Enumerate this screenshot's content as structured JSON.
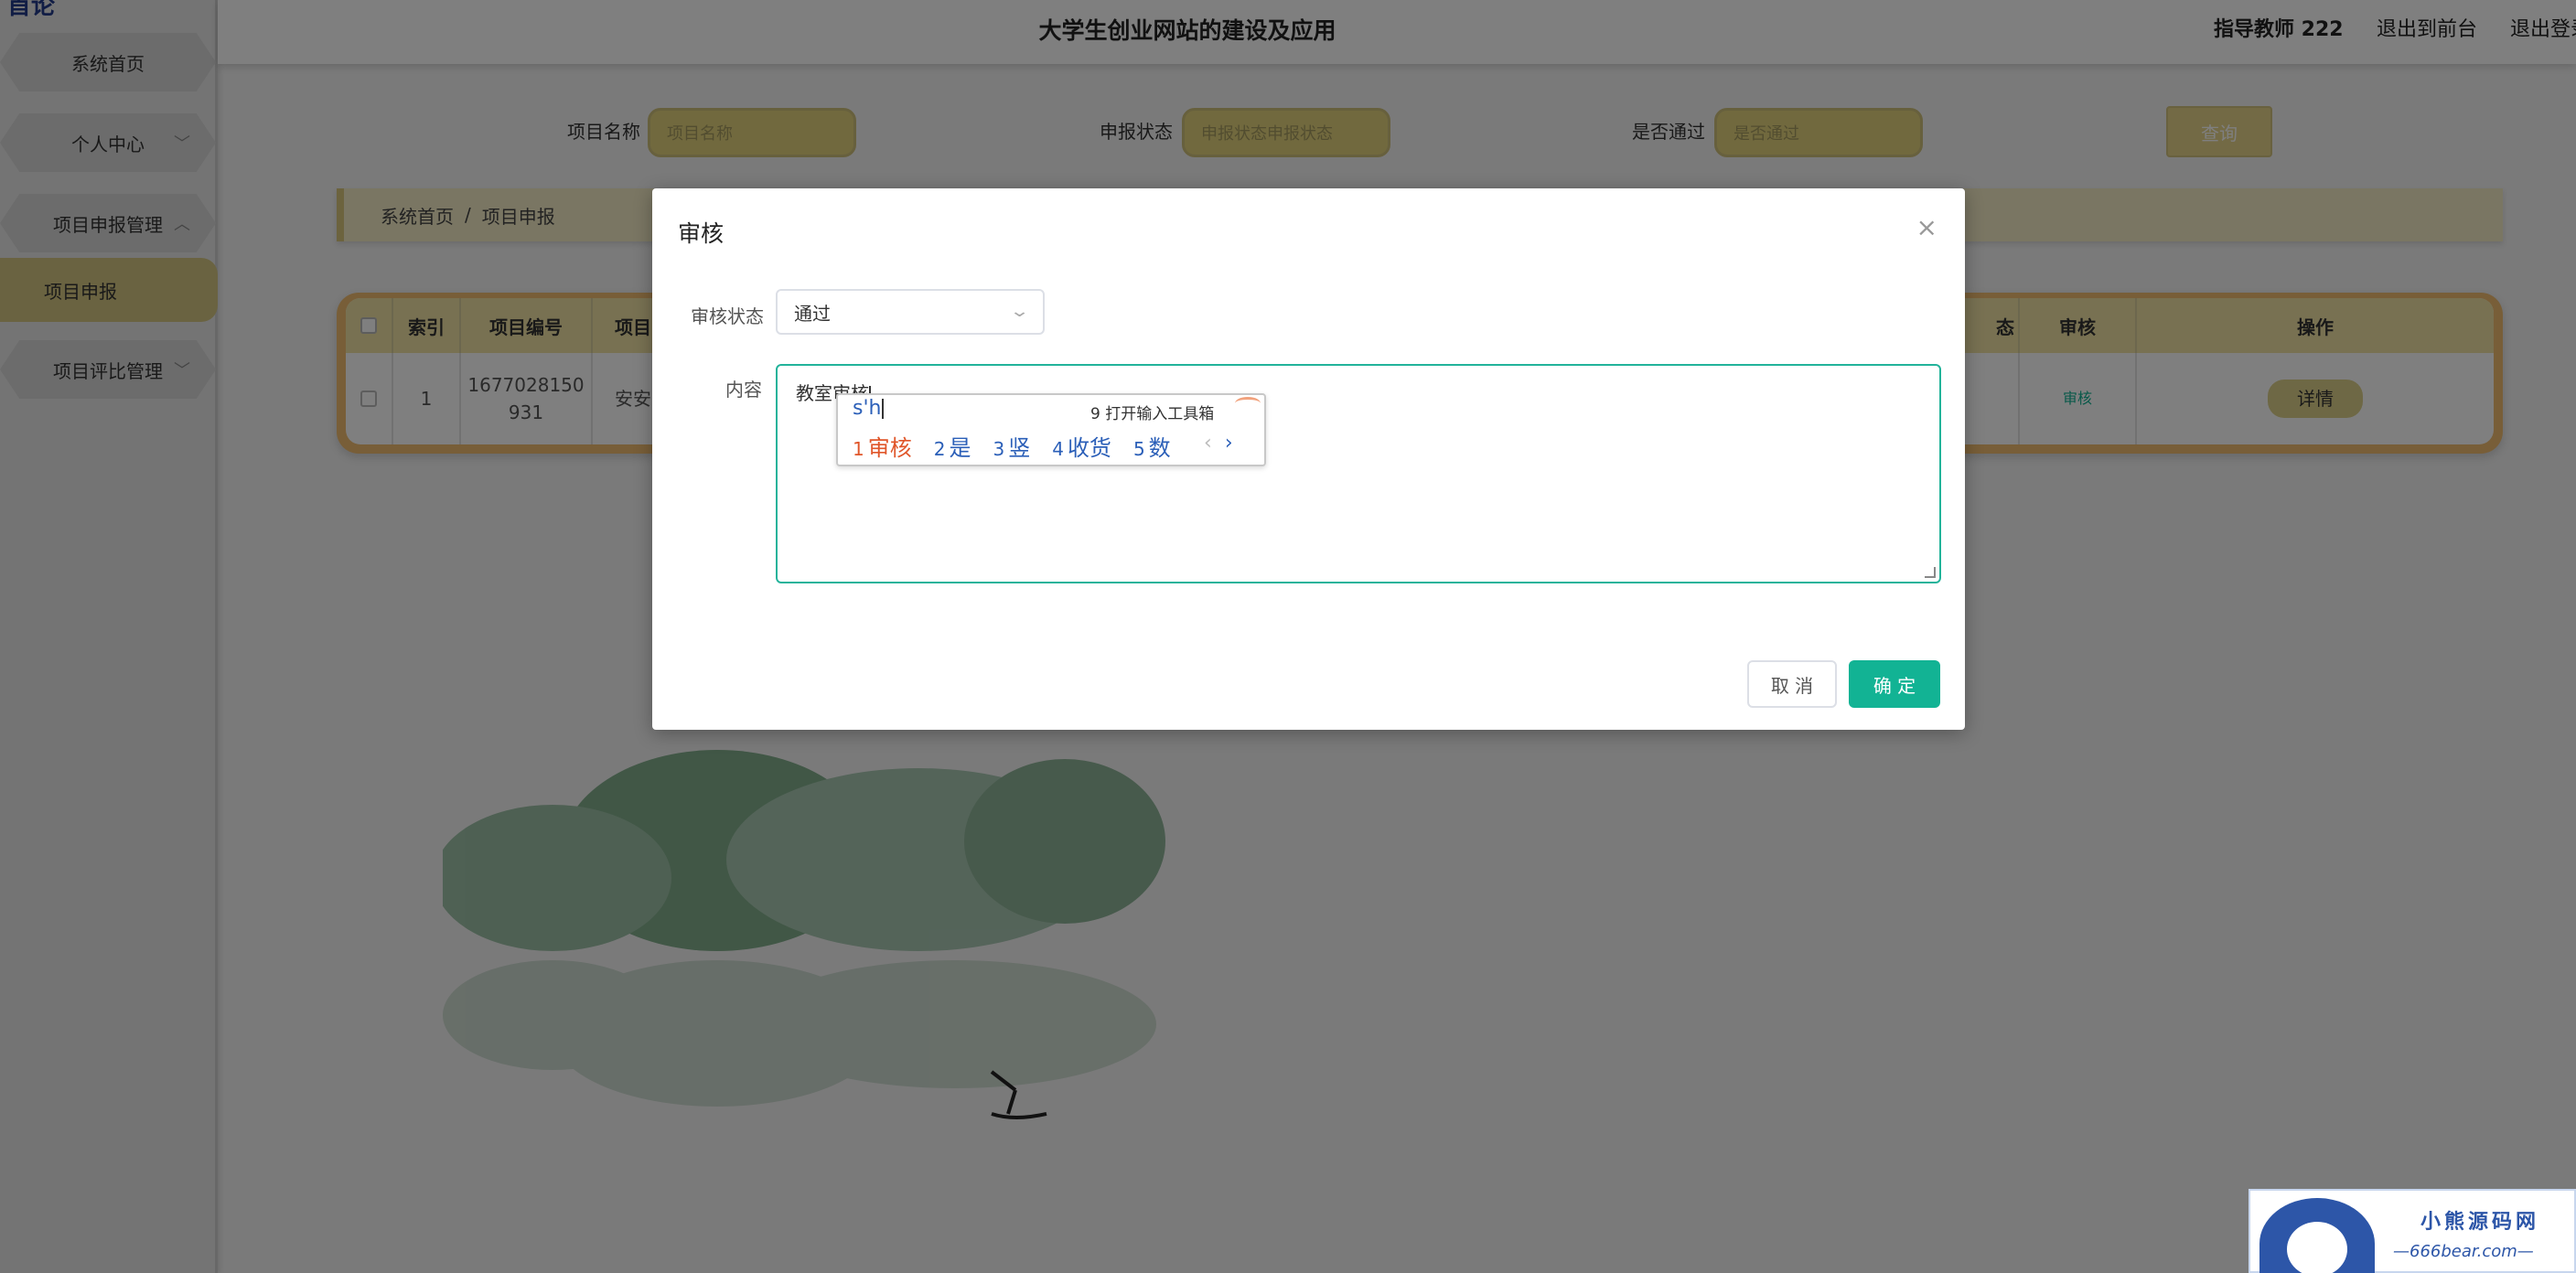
{
  "app": {
    "logo_text": "首论",
    "title": "大学生创业网站的建设及应用",
    "user": "指导教师 222",
    "link_front": "退出到前台",
    "link_logout": "退出登录"
  },
  "sidebar": {
    "items": [
      {
        "label": "系统首页"
      },
      {
        "label": "个人中心",
        "chevron": "﹀"
      },
      {
        "label": "项目申报管理",
        "chevron": "︿"
      },
      {
        "label": "项目申报"
      },
      {
        "label": "项目评比管理",
        "chevron": "﹀"
      }
    ]
  },
  "search": {
    "project_name_label": "项目名称",
    "project_name_placeholder": "项目名称",
    "status_label": "申报状态",
    "status_placeholder": "申报状态申报状态",
    "passed_label": "是否通过",
    "passed_placeholder": "是否通过",
    "query_button": "查询"
  },
  "breadcrumb": {
    "home": "系统首页",
    "sep": "/",
    "current": "项目申报"
  },
  "table": {
    "headers": [
      "",
      "索引",
      "项目编号",
      "项目",
      "态",
      "审核",
      "操作"
    ],
    "row": {
      "index": "1",
      "number_line1": "1677028150",
      "number_line2": "931",
      "project": "安安",
      "audit": "审核",
      "action": "详情"
    }
  },
  "dialog": {
    "title": "审核",
    "close": "×",
    "status_label": "审核状态",
    "status_value": "通过",
    "content_label": "内容",
    "content_value": "教室审核",
    "cancel": "取 消",
    "confirm": "确 定"
  },
  "ime": {
    "pinyin": "s'h",
    "tool": "9 打开输入工具箱",
    "candidates": [
      {
        "n": "1",
        "text": "审核"
      },
      {
        "n": "2",
        "text": "是"
      },
      {
        "n": "3",
        "text": "竖"
      },
      {
        "n": "4",
        "text": "收货"
      },
      {
        "n": "5",
        "text": "数"
      }
    ],
    "prev": "‹",
    "next": "›"
  },
  "watermark": {
    "line1": "小熊源码网",
    "line2": "—666bear.com—"
  },
  "colors": {
    "accent_gold": "#d4c682",
    "confirm_green": "#12b394",
    "table_frame": "#f0bd70"
  }
}
